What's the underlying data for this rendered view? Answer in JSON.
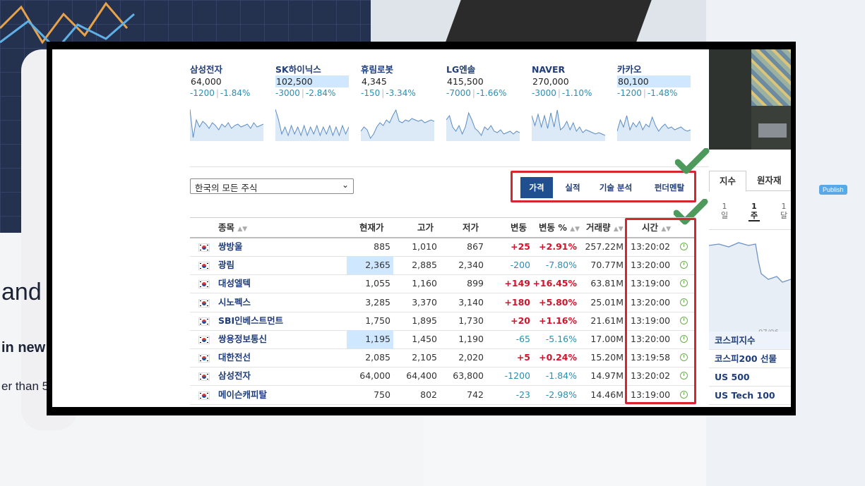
{
  "tickers": [
    {
      "name": "삼성전자",
      "price": "64,000",
      "change": "-1200",
      "pct": "-1.84%",
      "price_highlight": false
    },
    {
      "name": "SK하이닉스",
      "price": "102,500",
      "change": "-3000",
      "pct": "-2.84%",
      "price_highlight": true
    },
    {
      "name": "휴림로봇",
      "price": "4,345",
      "change": "-150",
      "pct": "-3.34%",
      "price_highlight": false
    },
    {
      "name": "LG엔솔",
      "price": "415,500",
      "change": "-7000",
      "pct": "-1.66%",
      "price_highlight": false
    },
    {
      "name": "NAVER",
      "price": "270,000",
      "change": "-3000",
      "pct": "-1.10%",
      "price_highlight": false
    },
    {
      "name": "카카오",
      "price": "80,100",
      "change": "-1200",
      "pct": "-1.48%",
      "price_highlight": true
    }
  ],
  "filter": {
    "selected": "한국의 모든 주식"
  },
  "tabs": [
    "가격",
    "실적",
    "기술 분석",
    "펀더멘탈"
  ],
  "active_tab": "가격",
  "table": {
    "columns": [
      "종목",
      "현재가",
      "고가",
      "저가",
      "변동",
      "변동 %",
      "거래량",
      "시간"
    ],
    "rows": [
      {
        "name": "쌍방울",
        "last": "885",
        "high": "1,010",
        "low": "867",
        "chg": "+25",
        "pct": "+2.91%",
        "vol": "257.22M",
        "time": "13:20:02",
        "dir": "up",
        "hl": false
      },
      {
        "name": "광림",
        "last": "2,365",
        "high": "2,885",
        "low": "2,340",
        "chg": "-200",
        "pct": "-7.80%",
        "vol": "70.77M",
        "time": "13:20:00",
        "dir": "down",
        "hl": true
      },
      {
        "name": "대성엘텍",
        "last": "1,055",
        "high": "1,160",
        "low": "899",
        "chg": "+149",
        "pct": "+16.45%",
        "vol": "63.81M",
        "time": "13:19:00",
        "dir": "up",
        "hl": false
      },
      {
        "name": "시노펙스",
        "last": "3,285",
        "high": "3,370",
        "low": "3,140",
        "chg": "+180",
        "pct": "+5.80%",
        "vol": "25.01M",
        "time": "13:20:00",
        "dir": "up",
        "hl": false
      },
      {
        "name": "SBI인베스트먼트",
        "last": "1,750",
        "high": "1,895",
        "low": "1,730",
        "chg": "+20",
        "pct": "+1.16%",
        "vol": "21.61M",
        "time": "13:19:00",
        "dir": "up",
        "hl": false
      },
      {
        "name": "쌍용정보통신",
        "last": "1,195",
        "high": "1,450",
        "low": "1,190",
        "chg": "-65",
        "pct": "-5.16%",
        "vol": "17.00M",
        "time": "13:20:00",
        "dir": "down",
        "hl": true
      },
      {
        "name": "대한전선",
        "last": "2,085",
        "high": "2,105",
        "low": "2,020",
        "chg": "+5",
        "pct": "+0.24%",
        "vol": "15.20M",
        "time": "13:19:58",
        "dir": "up",
        "hl": false
      },
      {
        "name": "삼성전자",
        "last": "64,000",
        "high": "64,400",
        "low": "63,800",
        "chg": "-1200",
        "pct": "-1.84%",
        "vol": "14.97M",
        "time": "13:20:02",
        "dir": "down",
        "hl": false
      },
      {
        "name": "메이슨캐피탈",
        "last": "750",
        "high": "802",
        "low": "742",
        "chg": "-23",
        "pct": "-2.98%",
        "vol": "14.46M",
        "time": "13:19:00",
        "dir": "down",
        "hl": false
      }
    ]
  },
  "right_panel": {
    "tabs": [
      "지수",
      "원자재"
    ],
    "periods": [
      {
        "num": "1",
        "unit": "일"
      },
      {
        "num": "1",
        "unit": "주"
      },
      {
        "num": "1",
        "unit": "달"
      }
    ],
    "chart_date": "07/06",
    "indices": [
      "코스피지수",
      "코스피200 선물",
      "US 500",
      "US Tech 100"
    ]
  },
  "background_text": {
    "line1": "and n",
    "line2": "in new",
    "line3": "er than 5",
    "publish": "Publish"
  },
  "colors": {
    "accent": "#1f4f8f",
    "up": "#d3122b",
    "down": "#2a8fb0",
    "highlight": "#d8262f",
    "check": "#4e9a5d"
  }
}
